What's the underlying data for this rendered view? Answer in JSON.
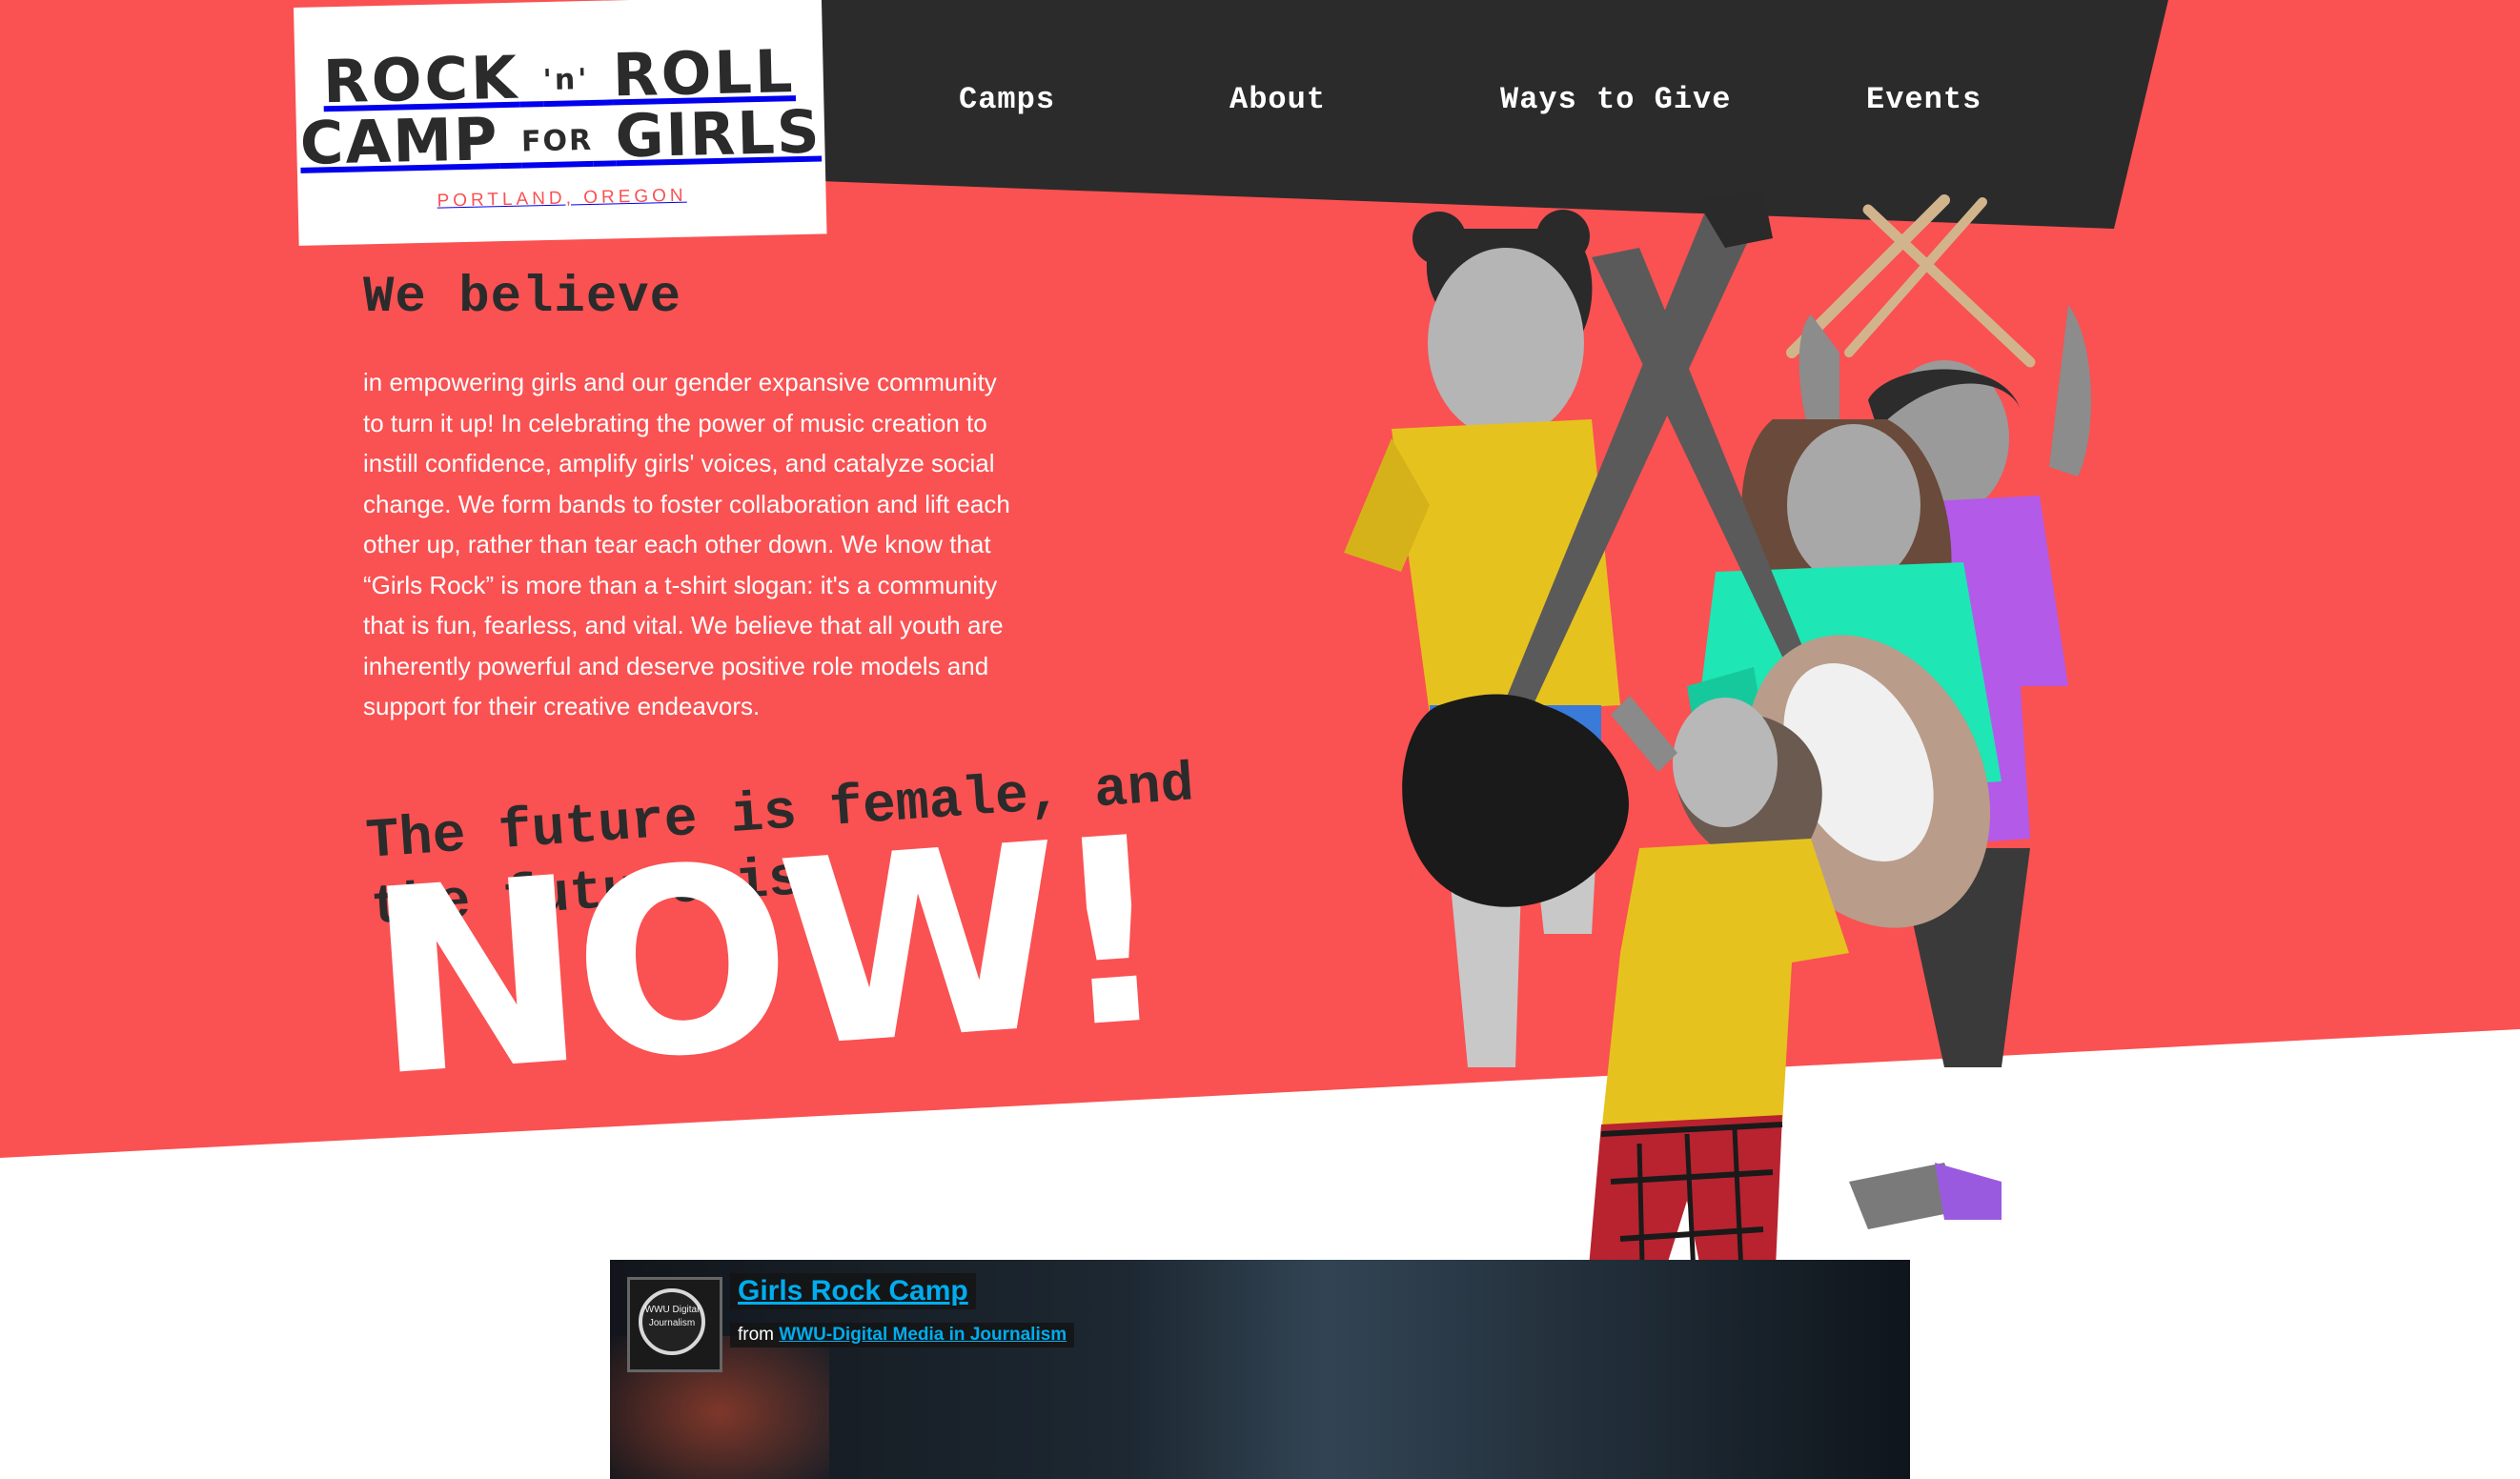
{
  "logo": {
    "line1a": "ROCK",
    "line1b": "'n'",
    "line1c": "ROLL",
    "line2a": "CAMP",
    "line2b": "FOR",
    "line2c": "GIRLS",
    "location": "PORTLAND, OREGON"
  },
  "nav": {
    "items": [
      {
        "label": "Camps"
      },
      {
        "label": "About"
      },
      {
        "label": "Ways to Give"
      },
      {
        "label": "Events"
      }
    ]
  },
  "intro": {
    "title": "We believe",
    "body": "in empowering girls and our gender expansive community to turn it up! In celebrating the power of music creation to instill confidence, amplify girls' voices, and catalyze social change. We form bands to foster collaboration and lift each other up, rather than tear each other down. We know that “Girls Rock” is more than a t-shirt slogan: it's a community that is fun, fearless, and vital. We believe that all youth are inherently powerful and deserve positive role models and support for their creative endeavors."
  },
  "tagline": {
    "text": "The future is female, and\nthe future is",
    "emphasis": "NOW!"
  },
  "video": {
    "avatar_text": "WWU Digital Journalism",
    "title": "Girls Rock Camp",
    "from_label": "from",
    "from_channel": "WWU-Digital Media in Journalism"
  },
  "colors": {
    "brand_red": "#fa5152",
    "dark": "#2b2b2b",
    "shirt_yellow": "#e6c21f",
    "shirt_teal": "#1ee6b4",
    "shirt_purple": "#b35ae8",
    "vimeo_blue": "#00adef"
  }
}
